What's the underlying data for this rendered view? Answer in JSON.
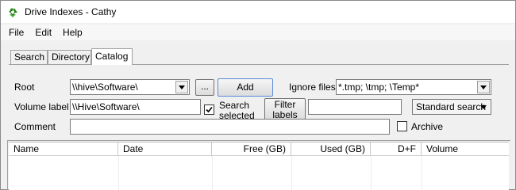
{
  "window": {
    "title": "Drive Indexes - Cathy"
  },
  "menu": [
    "File",
    "Edit",
    "Help"
  ],
  "tabs": [
    {
      "label": "Search",
      "active": false
    },
    {
      "label": "Directory",
      "active": false
    },
    {
      "label": "Catalog",
      "active": true
    }
  ],
  "form": {
    "root_label": "Root",
    "root_value": "\\\\hive\\Software\\",
    "browse_label": "...",
    "add_label": "Add",
    "ignore_label": "Ignore files",
    "ignore_value": "*.tmp; \\tmp; \\Temp*",
    "volume_label": "Volume label",
    "volume_value": "\\\\Hive\\Software\\",
    "search_selected_line1": "Search",
    "search_selected_line2": "selected",
    "search_selected_checked": true,
    "filter_labels_line1": "Filter",
    "filter_labels_line2": "labels",
    "filter_value": "",
    "search_mode": "Standard search",
    "comment_label": "Comment",
    "comment_value": "",
    "archive_label": "Archive",
    "archive_checked": false
  },
  "grid": {
    "columns": [
      "Name",
      "Date",
      "Free (GB)",
      "Used (GB)",
      "D+F",
      "Volume"
    ]
  },
  "icons": {
    "app": "recycle-arrows-icon",
    "dropdown": "chevron-down-icon",
    "check": "checkmark-icon"
  }
}
